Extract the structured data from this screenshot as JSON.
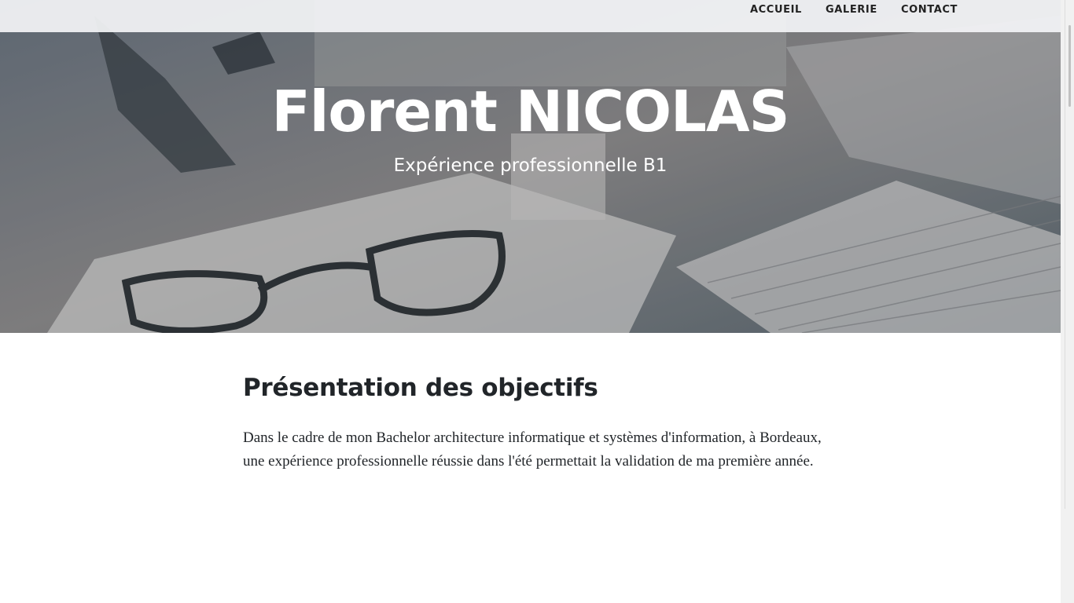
{
  "nav": {
    "items": [
      {
        "label": "ACCUEIL"
      },
      {
        "label": "GALERIE"
      },
      {
        "label": "CONTACT"
      }
    ]
  },
  "hero": {
    "title": "Florent NICOLAS",
    "subtitle": "Expérience professionnelle B1"
  },
  "main": {
    "heading": "Présentation des objectifs",
    "paragraph": "Dans le cadre de mon Bachelor architecture informatique et systèmes d'information, à Bordeaux, une expérience professionnelle réussie dans l'été permettait la validation de ma première année."
  },
  "colors": {
    "text": "#212529",
    "hero_text": "#ffffff",
    "navbar_bg": "#f3f4f6"
  },
  "icons": {
    "hero_background": "office-desk-photo"
  }
}
